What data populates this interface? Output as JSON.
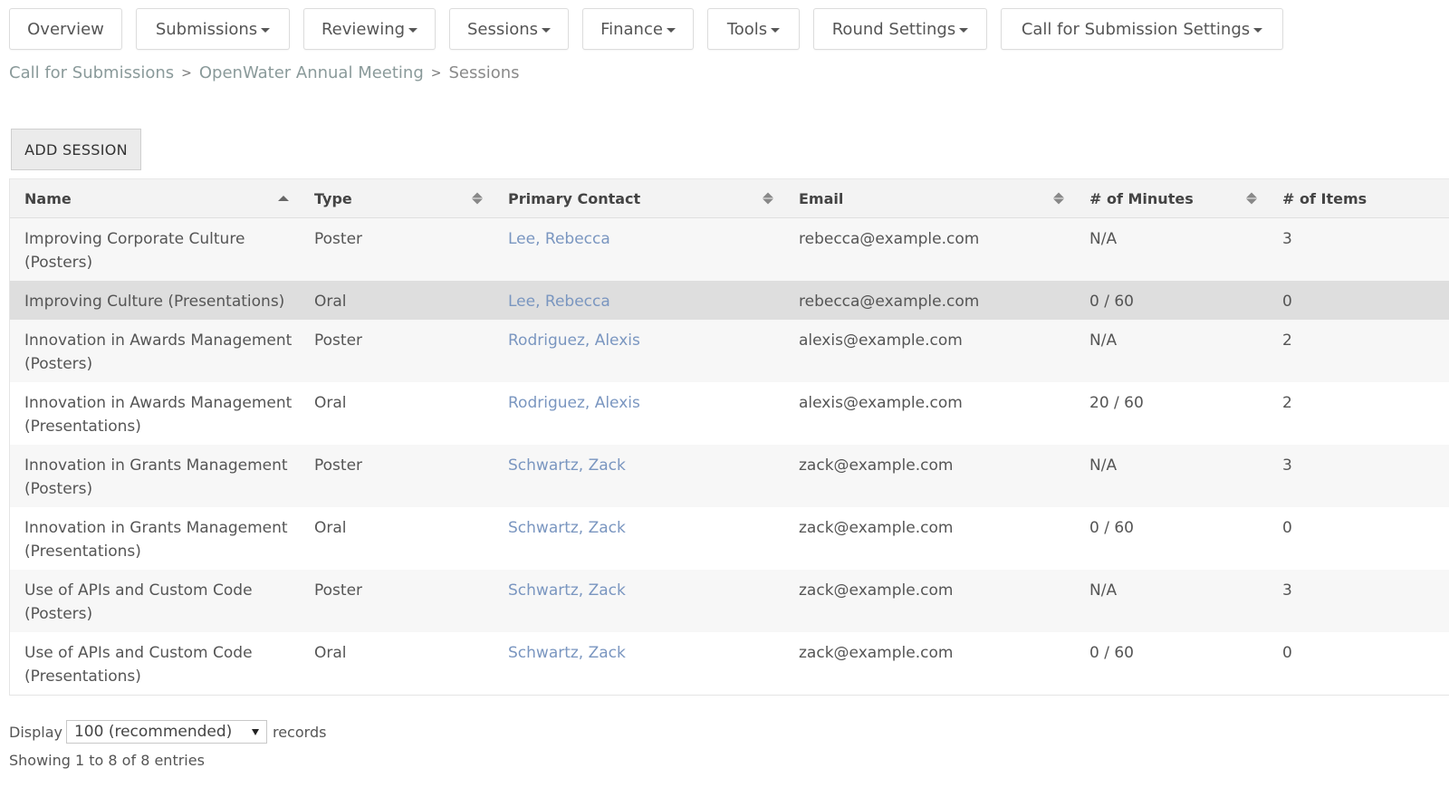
{
  "nav": [
    {
      "label": "Overview",
      "dropdown": false
    },
    {
      "label": "Submissions",
      "dropdown": true
    },
    {
      "label": "Reviewing",
      "dropdown": true
    },
    {
      "label": "Sessions",
      "dropdown": true
    },
    {
      "label": "Finance",
      "dropdown": true
    },
    {
      "label": "Tools",
      "dropdown": true
    },
    {
      "label": "Round Settings",
      "dropdown": true
    },
    {
      "label": "Call for Submission Settings",
      "dropdown": true
    }
  ],
  "breadcrumb": {
    "items": [
      "Call for Submissions",
      "OpenWater Annual Meeting"
    ],
    "separator": ">",
    "current": "Sessions"
  },
  "add_button": "ADD SESSION",
  "table": {
    "columns": [
      {
        "label": "Name",
        "sort": "asc"
      },
      {
        "label": "Type",
        "sort": "both"
      },
      {
        "label": "Primary Contact",
        "sort": "both"
      },
      {
        "label": "Email",
        "sort": "both"
      },
      {
        "label": "# of Minutes",
        "sort": "both"
      },
      {
        "label": "# of Items",
        "sort": "none"
      }
    ],
    "rows": [
      {
        "name": "Improving Corporate Culture (Posters)",
        "type": "Poster",
        "contact": "Lee, Rebecca",
        "email": "rebecca@example.com",
        "minutes": "N/A",
        "items": "3"
      },
      {
        "name": "Improving Culture (Presentations)",
        "type": "Oral",
        "contact": "Lee, Rebecca",
        "email": "rebecca@example.com",
        "minutes": "0 / 60",
        "items": "0",
        "hovered": true
      },
      {
        "name": "Innovation in Awards Management (Posters)",
        "type": "Poster",
        "contact": "Rodriguez, Alexis",
        "email": "alexis@example.com",
        "minutes": "N/A",
        "items": "2"
      },
      {
        "name": "Innovation in Awards Management (Presentations)",
        "type": "Oral",
        "contact": "Rodriguez, Alexis",
        "email": "alexis@example.com",
        "minutes": "20 / 60",
        "items": "2"
      },
      {
        "name": "Innovation in Grants Management (Posters)",
        "type": "Poster",
        "contact": "Schwartz, Zack",
        "email": "zack@example.com",
        "minutes": "N/A",
        "items": "3"
      },
      {
        "name": "Innovation in Grants Management (Presentations)",
        "type": "Oral",
        "contact": "Schwartz, Zack",
        "email": "zack@example.com",
        "minutes": "0 / 60",
        "items": "0"
      },
      {
        "name": "Use of APIs and Custom Code (Posters)",
        "type": "Poster",
        "contact": "Schwartz, Zack",
        "email": "zack@example.com",
        "minutes": "N/A",
        "items": "3"
      },
      {
        "name": "Use of APIs and Custom Code (Presentations)",
        "type": "Oral",
        "contact": "Schwartz, Zack",
        "email": "zack@example.com",
        "minutes": "0 / 60",
        "items": "0"
      }
    ]
  },
  "footer": {
    "display_label": "Display",
    "page_size": "100 (recommended)",
    "records_label": "records",
    "info": "Showing 1 to 8 of 8 entries"
  },
  "colors": {
    "link": "#7a96c0",
    "header_bg": "#f3f3f3",
    "row_hover": "#dedede"
  }
}
